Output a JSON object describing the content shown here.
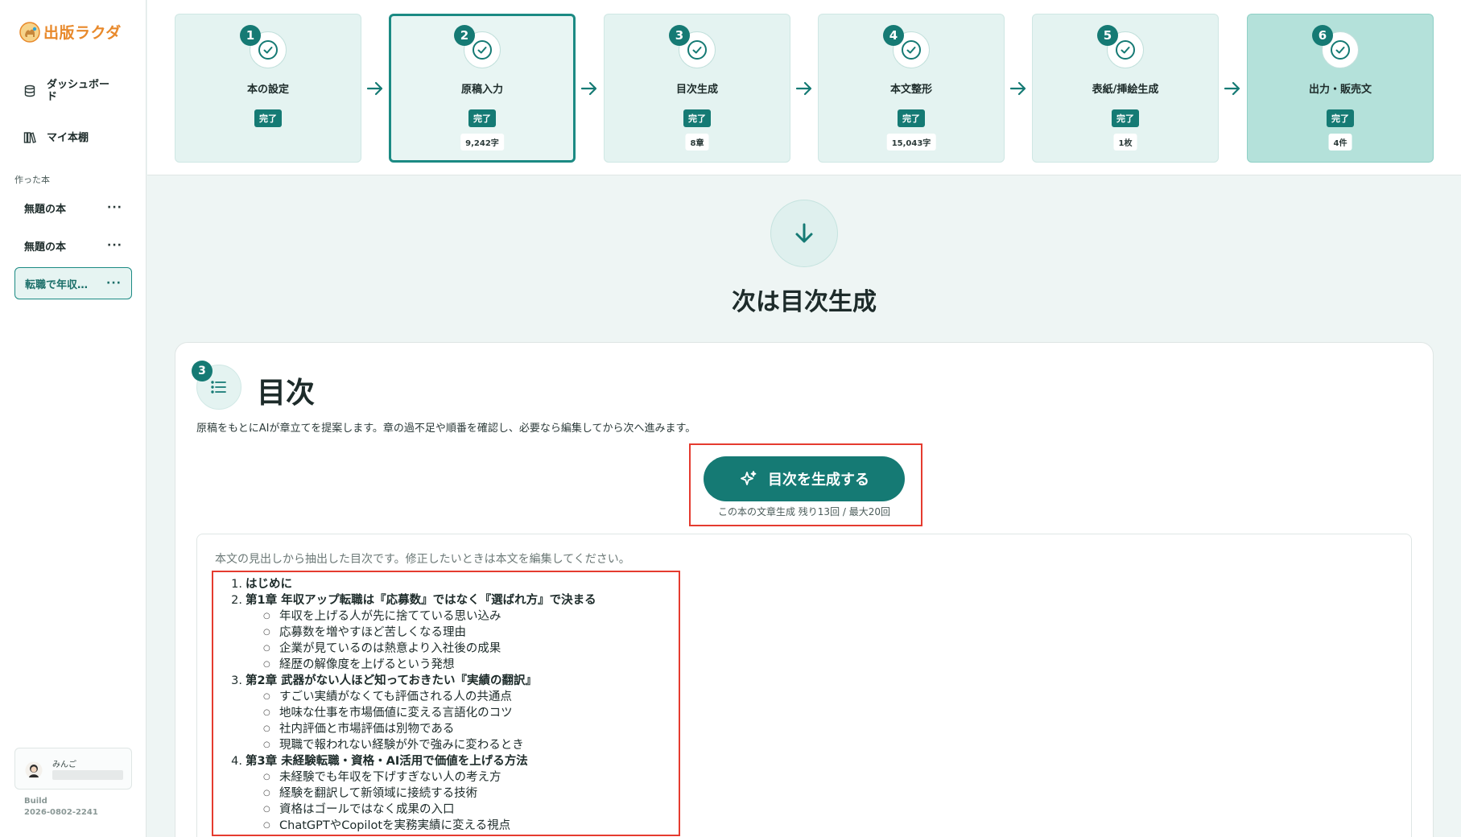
{
  "app": {
    "name": "出版ラクダ"
  },
  "sidebar": {
    "nav": [
      {
        "label": "ダッシュボード",
        "icon": "database-icon"
      },
      {
        "label": "マイ本棚",
        "icon": "bookshelf-icon"
      }
    ],
    "section_label": "作った本",
    "books": [
      {
        "title": "無題の本",
        "more": "···",
        "active": false
      },
      {
        "title": "無題の本",
        "more": "···",
        "active": false
      },
      {
        "title": "転職で年収…",
        "more": "···",
        "active": true
      }
    ],
    "user": {
      "name": "みんご"
    },
    "build": {
      "label": "Build",
      "value": "2026-0802-2241"
    }
  },
  "steps": [
    {
      "num": "1",
      "label": "本の設定",
      "status": "完了",
      "count": ""
    },
    {
      "num": "2",
      "label": "原稿入力",
      "status": "完了",
      "count": "9,242字"
    },
    {
      "num": "3",
      "label": "目次生成",
      "status": "完了",
      "count": "8章"
    },
    {
      "num": "4",
      "label": "本文整形",
      "status": "完了",
      "count": "15,043字"
    },
    {
      "num": "5",
      "label": "表紙/挿絵生成",
      "status": "完了",
      "count": "1枚"
    },
    {
      "num": "6",
      "label": "出力・販売文",
      "status": "完了",
      "count": "4件"
    }
  ],
  "next": {
    "title": "次は目次生成"
  },
  "card": {
    "num": "3",
    "title": "目次",
    "description": "原稿をもとにAIが章立てを提案します。章の過不足や順番を確認し、必要なら編集してから次へ進みます。",
    "button_label": "目次を生成する",
    "quota_note": "この本の文章生成 残り13回 / 最大20回",
    "toc_hint": "本文の見出しから抽出した目次です。修正したいときは本文を編集してください。",
    "toc": [
      {
        "n": "1.",
        "title": "はじめに",
        "sections": []
      },
      {
        "n": "2.",
        "title": "第1章 年収アップ転職は『応募数』ではなく『選ばれ方』で決まる",
        "sections": [
          "年収を上げる人が先に捨てている思い込み",
          "応募数を増やすほど苦しくなる理由",
          "企業が見ているのは熱意より入社後の成果",
          "経歴の解像度を上げるという発想"
        ]
      },
      {
        "n": "3.",
        "title": "第2章 武器がない人ほど知っておきたい『実績の翻訳』",
        "sections": [
          "すごい実績がなくても評価される人の共通点",
          "地味な仕事を市場価値に変える言語化のコツ",
          "社内評価と市場評価は別物である",
          "現職で報われない経験が外で強みに変わるとき"
        ]
      },
      {
        "n": "4.",
        "title": "第3章 未経験転職・資格・AI活用で価値を上げる方法",
        "sections": [
          "未経験でも年収を下げすぎない人の考え方",
          "経験を翻訳して新領域に接続する技術",
          "資格はゴールではなく成果の入口",
          "ChatGPTやCopilotを実務実績に変える視点"
        ]
      }
    ]
  },
  "colors": {
    "accent": "#157a74",
    "logo": "#e8892b",
    "highlight": "#e53b2f"
  }
}
